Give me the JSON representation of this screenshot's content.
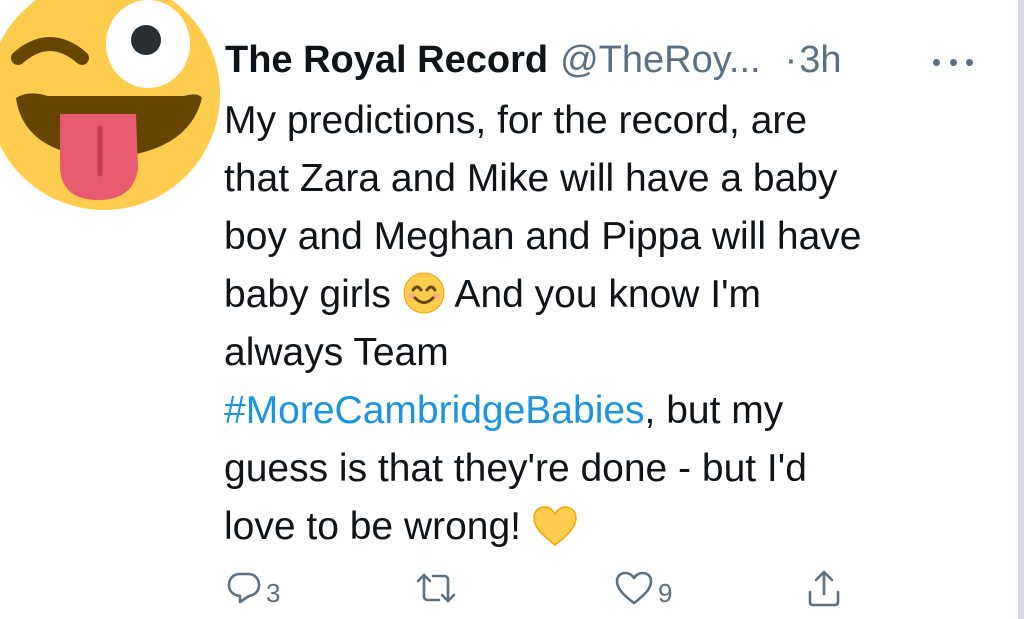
{
  "author": {
    "display_name": "The Royal Record",
    "handle": "@TheRoy...",
    "separator": "·",
    "time": "3h",
    "avatar_icon": "winking-tongue-emoji-icon"
  },
  "tweet": {
    "lines": [
      {
        "text": "My predictions, for the record, are"
      },
      {
        "text": "that Zara and Mike will have a baby"
      },
      {
        "text": "boy and Meghan and Pippa will have"
      },
      {
        "text_before": "baby girls ",
        "emoji": "smiling-face-emoji-icon",
        "text_after": " And you know I'm"
      },
      {
        "text": "always Team"
      },
      {
        "hashtag": "#MoreCambridgeBabies",
        "text_after": ", but my"
      },
      {
        "text": "guess is that they're done - but I'd"
      },
      {
        "text_before": "love to be wrong! ",
        "emoji": "yellow-heart-emoji-icon"
      }
    ]
  },
  "actions": {
    "reply_icon": "reply-icon",
    "reply_count": "3",
    "retweet_icon": "retweet-icon",
    "like_icon": "heart-icon",
    "like_count": "9",
    "share_icon": "share-icon"
  },
  "colors": {
    "text": "#0f1419",
    "secondary": "#5b7083",
    "link": "#1b95e0"
  }
}
